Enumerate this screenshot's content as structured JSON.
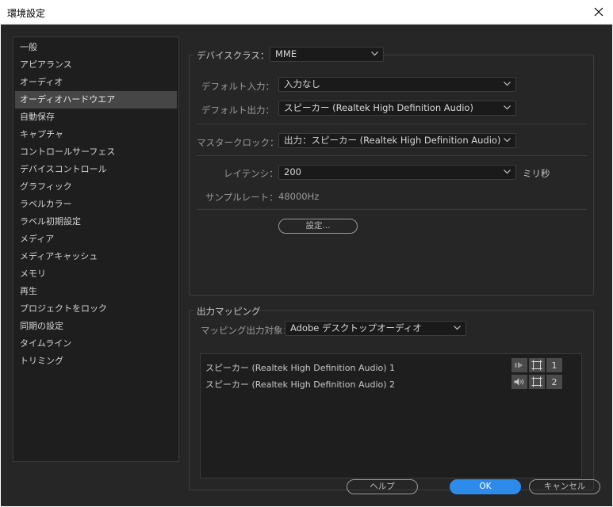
{
  "window": {
    "title": "環境設定"
  },
  "sidebar": {
    "items": [
      {
        "label": "一般"
      },
      {
        "label": "アピアランス"
      },
      {
        "label": "オーディオ"
      },
      {
        "label": "オーディオハードウエア",
        "selected": true
      },
      {
        "label": "自動保存"
      },
      {
        "label": "キャプチャ"
      },
      {
        "label": "コントロールサーフェス"
      },
      {
        "label": "デバイスコントロール"
      },
      {
        "label": "グラフィック"
      },
      {
        "label": "ラベルカラー"
      },
      {
        "label": "ラベル初期設定"
      },
      {
        "label": "メディア"
      },
      {
        "label": "メディアキャッシュ"
      },
      {
        "label": "メモリ"
      },
      {
        "label": "再生"
      },
      {
        "label": "プロジェクトをロック"
      },
      {
        "label": "同期の設定"
      },
      {
        "label": "タイムライン"
      },
      {
        "label": "トリミング"
      }
    ]
  },
  "device": {
    "class_label": "デバイスクラス：",
    "class_value": "MME",
    "default_input_label": "デフォルト入力：",
    "default_input_value": "入力なし",
    "default_output_label": "デフォルト出力：",
    "default_output_value": "スピーカー (Realtek High Definition Audio)",
    "master_clock_label": "マスタークロック：",
    "master_clock_value": "出力：スピーカー (Realtek High Definition Audio)",
    "latency_label": "レイテンシ：",
    "latency_value": "200",
    "latency_unit": "ミリ秒",
    "sample_rate_label": "サンプルレート：",
    "sample_rate_value": "48000Hz",
    "settings_button": "設定..."
  },
  "output_mapping": {
    "title": "出力マッピング",
    "target_label": "マッピング出力対象：",
    "target_value": "Adobe デスクトップオーディオ",
    "channels": [
      {
        "name": "スピーカー (Realtek High Definition Audio) 1",
        "number": "1"
      },
      {
        "name": "スピーカー (Realtek High Definition Audio) 2",
        "number": "2"
      }
    ]
  },
  "footer": {
    "help_button": "ヘルプ",
    "ok_button": "OK",
    "cancel_button": "キャンセル"
  },
  "colors": {
    "accent": "#2d8ceb",
    "panel": "#262626",
    "selected_item": "#464646"
  }
}
